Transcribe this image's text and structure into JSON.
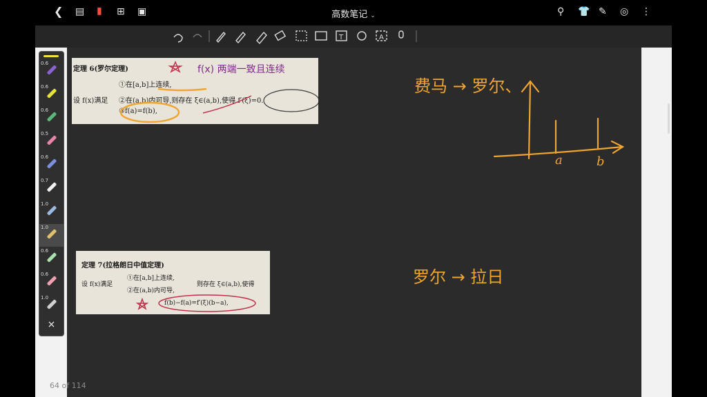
{
  "app": {
    "title": "高数笔记"
  },
  "toolbar": {
    "tools": [
      "undo-icon",
      "redo-icon",
      "pen-icon",
      "fountain-pen-icon",
      "highlighter-icon",
      "eraser-icon",
      "lasso-icon",
      "image-icon",
      "text-box-icon",
      "shape-icon",
      "ocr-icon",
      "microphone-icon"
    ]
  },
  "pen_tray": {
    "pens": [
      {
        "size": "0.6",
        "color": "#8a63d2"
      },
      {
        "size": "0.6",
        "color": "#e6e23a"
      },
      {
        "size": "0.6",
        "color": "#5ab87a"
      },
      {
        "size": "0.5",
        "color": "#e884a8"
      },
      {
        "size": "0.6",
        "color": "#7b8fe0"
      },
      {
        "size": "0.7",
        "color": "#f0f0f0"
      },
      {
        "size": "1.0",
        "color": "#9cb8e0"
      },
      {
        "size": "1.0",
        "color": "#e0c06a"
      },
      {
        "size": "0.6",
        "color": "#a8e0b0"
      },
      {
        "size": "0.6",
        "color": "#f0a0b0"
      },
      {
        "size": "1.0",
        "color": "#d0d0d0"
      }
    ],
    "close_label": "×"
  },
  "page": {
    "indicator": "64 of 114"
  },
  "photo1": {
    "heading": "定理 6(罗尔定理)",
    "line1": "①在[a,b]上连续,",
    "line2": "②在(a,b)内可导,则存在 ξ∈(a,b),使得 f′(ξ)=0.",
    "line3": "③f(a)=f(b),",
    "lead": "设 f(x)满足",
    "handwrite": "f(x) 两端一致且连续"
  },
  "photo2": {
    "heading": "定理 7(拉格朗日中值定理)",
    "lead": "设 f(x)满足",
    "line1": "①在[a,b]上连续,",
    "line2": "②在(a,b)内可导,",
    "tail": "则存在 ξ∈(a,b),使得",
    "formula": "f(b)−f(a)=f′(ξ)(b−a),"
  },
  "notes": {
    "note1": "费马 → 罗尔、",
    "note2": "罗尔 → 拉日",
    "axis_a": "a",
    "axis_b": "b"
  }
}
